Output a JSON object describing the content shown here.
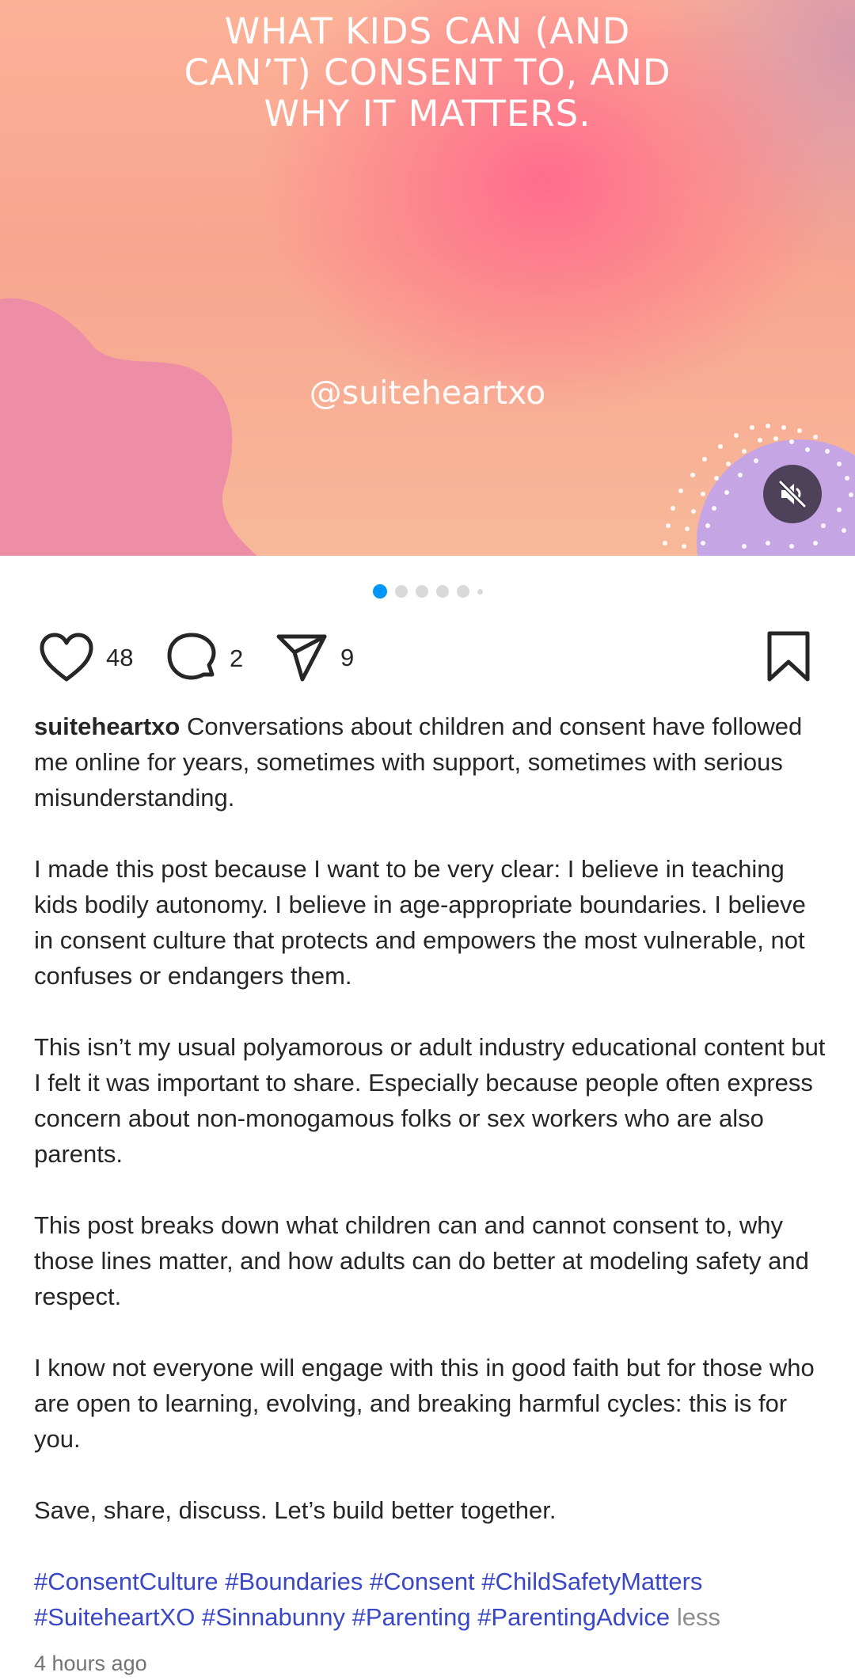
{
  "post": {
    "media": {
      "title": "WHAT KIDS CAN (AND CAN’T) CONSENT TO, AND WHY IT MATTERS.",
      "handle": "@suiteheartxo",
      "mute_icon": "speaker-muted-icon"
    },
    "carousel": {
      "slides": 6,
      "current": 1
    },
    "actions": {
      "likes": "48",
      "comments": "2",
      "shares": "9",
      "icons": [
        "heart-icon",
        "comment-icon",
        "share-icon",
        "bookmark-icon"
      ]
    },
    "caption": {
      "username": "suiteheartxo",
      "paragraphs": [
        "Conversations about children and consent have followed me online for years, sometimes with support, sometimes with serious misunderstanding.",
        "I made this post because I want to be very clear: I believe in teaching kids bodily autonomy. I believe in age-appropriate boundaries. I believe in consent culture that protects and empowers the most vulnerable, not confuses or endangers them.",
        "This isn’t my usual polyamorous or adult industry educational content but I felt it was important to share. Especially because people often express concern about non-monogamous folks or sex workers who are also parents.",
        "This post breaks down what children can and cannot consent to, why those lines matter, and how adults can do better at modeling safety and respect.",
        "I know not everyone will engage with this in good faith but for those who are open to learning, evolving, and breaking harmful cycles: this is for you.",
        "Save, share, discuss. Let’s build better together."
      ],
      "hashtags": [
        "#ConsentCulture",
        "#Boundaries",
        "#Consent",
        "#ChildSafetyMatters",
        "#SuiteheartXO",
        "#Sinnabunny",
        "#Parenting",
        "#ParentingAdvice"
      ],
      "less_label": "less"
    },
    "timestamp": "4 hours ago"
  },
  "colors": {
    "link": "#3a48c8",
    "active_dot": "#0095f6",
    "text": "#262626",
    "muted": "#737373"
  }
}
